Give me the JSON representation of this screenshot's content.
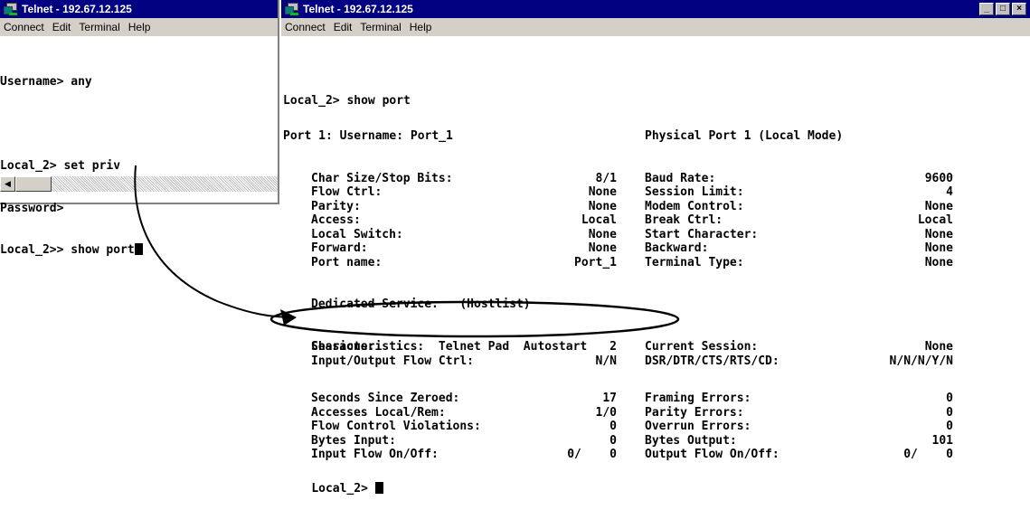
{
  "left": {
    "title": "Telnet - 192.67.12.125",
    "menu": [
      "Connect",
      "Edit",
      "Terminal",
      "Help"
    ],
    "lines": [
      "Username> any",
      "",
      "Local_2> set priv",
      "Password>",
      "Local_2>> show port"
    ]
  },
  "right": {
    "title": "Telnet - 192.67.12.125",
    "menu": [
      "Connect",
      "Edit",
      "Terminal",
      "Help"
    ],
    "prompt1": "Local_2> show port",
    "port_header_left": "Port 1: Username: Port_1",
    "port_header_right": "Physical Port 1 (Local Mode)",
    "settings": [
      {
        "l": "Char Size/Stop Bits:",
        "lv": "8/1",
        "r": "Baud Rate:",
        "rv": "9600"
      },
      {
        "l": "Flow Ctrl:",
        "lv": "None",
        "r": "Session Limit:",
        "rv": "4"
      },
      {
        "l": "Parity:",
        "lv": "None",
        "r": "Modem Control:",
        "rv": "None"
      },
      {
        "l": "Access:",
        "lv": "Local",
        "r": "Break Ctrl:",
        "rv": "Local"
      },
      {
        "l": "Local Switch:",
        "lv": "None",
        "r": "Start Character:",
        "rv": "None"
      },
      {
        "l": "Forward:",
        "lv": "None",
        "r": "Backward:",
        "rv": "None"
      },
      {
        "l": "Port name:",
        "lv": "Port_1",
        "r": "Terminal Type:",
        "rv": "None"
      }
    ],
    "dedicated": "Dedicated Service:   (Hostlist)",
    "characteristics": "Characteristics:  Telnet Pad  Autostart",
    "sessions": [
      {
        "l": "Sessions:",
        "lv": "2",
        "r": "Current Session:",
        "rv": "None"
      },
      {
        "l": "Input/Output Flow Ctrl:",
        "lv": "N/N",
        "r": "DSR/DTR/CTS/RTS/CD:",
        "rv": "N/N/N/Y/N"
      }
    ],
    "counters": [
      {
        "l": "Seconds Since Zeroed:",
        "lv": "17",
        "r": "Framing Errors:",
        "rv": "0"
      },
      {
        "l": "Accesses Local/Rem:",
        "lv": "1/0",
        "r": "Parity Errors:",
        "rv": "0"
      },
      {
        "l": "Flow Control Violations:",
        "lv": "0",
        "r": "Overrun Errors:",
        "rv": "0"
      },
      {
        "l": "Bytes Input:",
        "lv": "0",
        "r": "Bytes Output:",
        "rv": "101"
      },
      {
        "l": "Input Flow On/Off:",
        "lv": "0/    0",
        "r": "Output Flow On/Off:",
        "rv": "0/    0"
      }
    ],
    "prompt2": "Local_2> "
  }
}
